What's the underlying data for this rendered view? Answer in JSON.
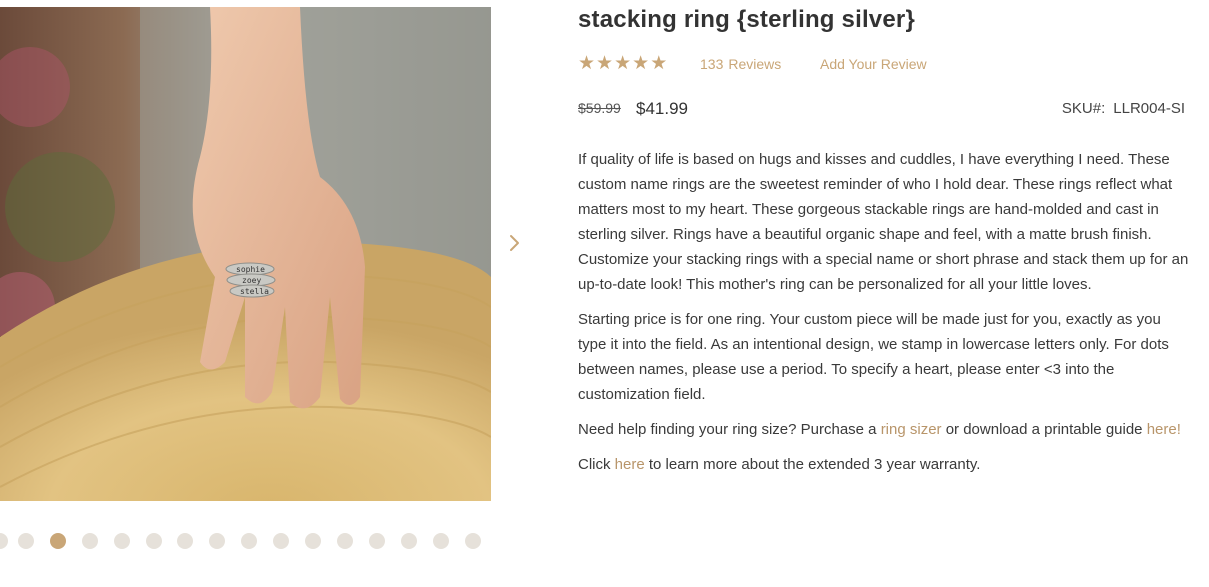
{
  "product": {
    "title": "stacking ring {sterling silver}",
    "rating_stars": 5,
    "review_count": "133",
    "reviews_label": "Reviews",
    "add_review_label": "Add Your Review",
    "old_price": "$59.99",
    "price": "$41.99",
    "sku_label": "SKU#:",
    "sku_value": "LLR004-SI"
  },
  "description": {
    "p1": "If quality of life is based on hugs and kisses and cuddles, I have everything I need. These custom name rings are the sweetest reminder of who I hold dear. These rings reflect what matters most to my heart. These gorgeous stackable rings are hand-molded and cast in sterling silver. Rings have a beautiful organic shape and feel, with a matte brush finish. Customize your stacking rings with a special name or short phrase and stack them up for an up-to-date look! This mother's ring can be personalized for all your little loves.",
    "p2": "Starting price is for one ring. Your custom piece will be made just for you, exactly as you type it into the field. As an intentional design, we stamp in lowercase letters only. For dots between names, please use a period. To specify a heart, please enter <3 into the customization field.",
    "p3_before": "Need help finding your ring size? Purchase a ",
    "p3_link1": "ring sizer",
    "p3_middle": " or download a printable guide ",
    "p3_link2": "here!",
    "p4_before": "Click ",
    "p4_link": "here",
    "p4_after": " to learn more about the extended 3 year warranty."
  },
  "gallery": {
    "ring_texts": [
      "sophie",
      "zoey",
      "stella"
    ],
    "dot_count": 16,
    "active_dot": 1
  },
  "colors": {
    "accent": "#c9a677",
    "link": "#b8956a",
    "dot_inactive": "#e6e1da"
  },
  "icons": {
    "next": "chevron-right-icon",
    "star": "star-icon"
  }
}
